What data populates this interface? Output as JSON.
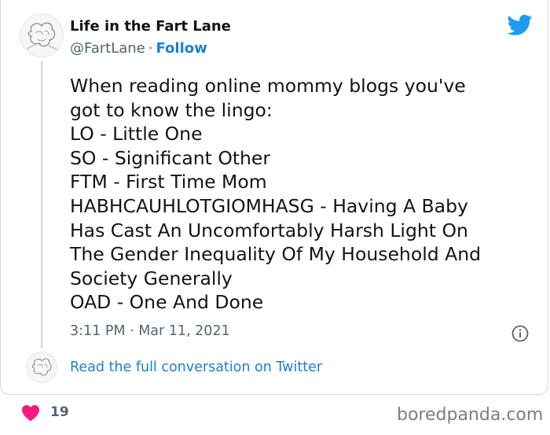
{
  "tweet": {
    "author_name": "Life in the Fart Lane",
    "handle": "@FartLane",
    "separator": "·",
    "follow_label": "Follow",
    "lines": [
      "When reading online mommy blogs you've",
      "got to know the lingo:",
      "LO - Little One",
      "SO - Significant Other",
      "FTM - First Time Mom",
      "HABHCAUHLOTGIOMHASG - Having A Baby",
      "Has Cast An Uncomfortably Harsh Light On",
      "The Gender Inequality Of My Household And",
      "Society Generally",
      "OAD - One And Done"
    ],
    "timestamp": "3:11 PM · Mar 11, 2021",
    "read_more_label": "Read the full conversation on Twitter",
    "like_count": "19",
    "icons": {
      "brand": "twitter-bird-icon",
      "info": "info-icon",
      "like": "heart-icon"
    },
    "colors": {
      "twitter_blue": "#1d9bf0",
      "link": "#1d7fd1",
      "heart": "#f91880",
      "muted": "#536471"
    }
  },
  "watermark": "boredpanda.com"
}
